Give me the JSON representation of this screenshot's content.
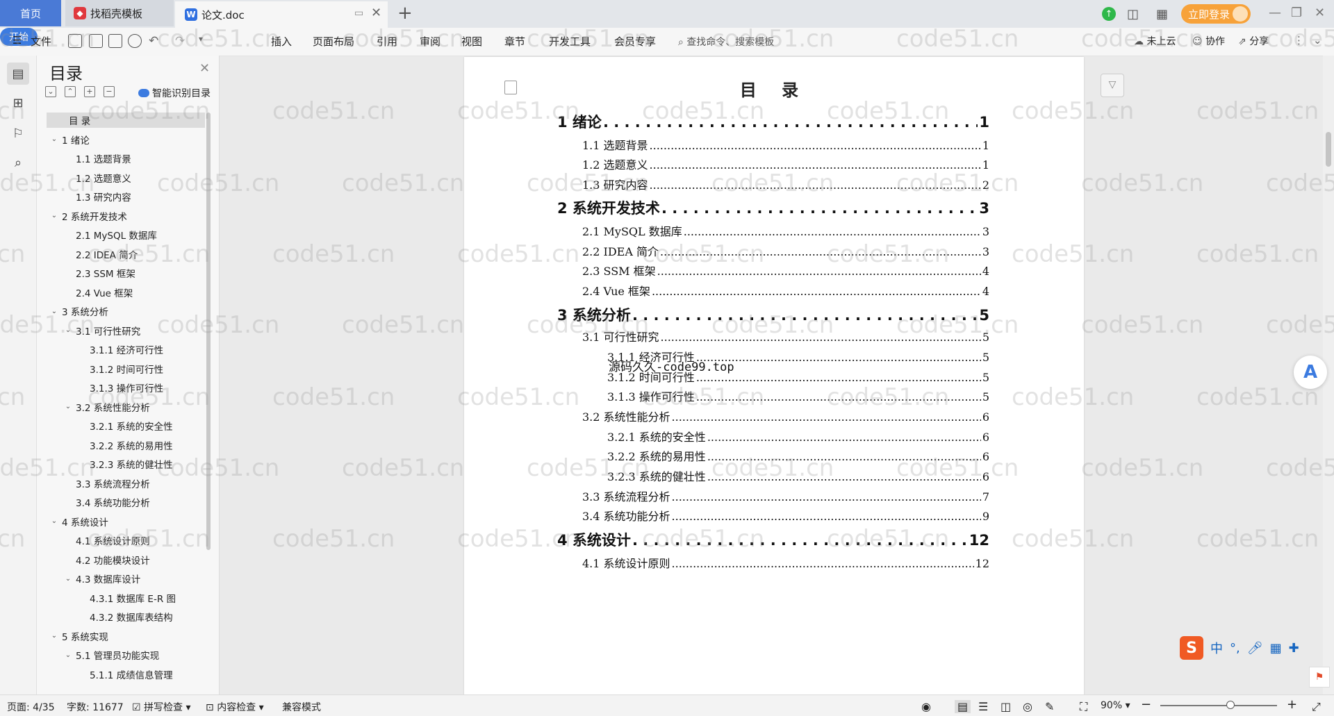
{
  "tabs": {
    "home": "首页",
    "template": "找稻壳模板",
    "doc": "论文.doc",
    "login": "立即登录"
  },
  "ribbon": {
    "file": "文件",
    "items": [
      "开始",
      "插入",
      "页面布局",
      "引用",
      "审阅",
      "视图",
      "章节",
      "开发工具",
      "会员专享"
    ],
    "search": "查找命令、搜索模板",
    "cloud": "未上云",
    "collab": "协作",
    "share": "分享"
  },
  "toc_pane": {
    "title": "目录",
    "smart": "智能识别目录",
    "items": [
      {
        "text": "目  录",
        "level": 0,
        "chev": ""
      },
      {
        "text": "1  绪论",
        "level": 0,
        "chev": "v"
      },
      {
        "text": "1.1  选题背景",
        "level": 1,
        "chev": ""
      },
      {
        "text": "1.2  选题意义",
        "level": 1,
        "chev": ""
      },
      {
        "text": "1.3  研究内容",
        "level": 1,
        "chev": ""
      },
      {
        "text": "2  系统开发技术",
        "level": 0,
        "chev": "v"
      },
      {
        "text": "2.1 MySQL 数据库",
        "level": 1,
        "chev": ""
      },
      {
        "text": "2.2 IDEA 简介",
        "level": 1,
        "chev": ""
      },
      {
        "text": "2.3 SSM 框架",
        "level": 1,
        "chev": ""
      },
      {
        "text": "2.4 Vue 框架",
        "level": 1,
        "chev": ""
      },
      {
        "text": "3  系统分析",
        "level": 0,
        "chev": "v"
      },
      {
        "text": "3.1  可行性研究",
        "level": 1,
        "chev": "v"
      },
      {
        "text": "3.1.1  经济可行性",
        "level": 2,
        "chev": ""
      },
      {
        "text": "3.1.2  时间可行性",
        "level": 2,
        "chev": ""
      },
      {
        "text": "3.1.3  操作可行性",
        "level": 2,
        "chev": ""
      },
      {
        "text": "3.2  系统性能分析",
        "level": 1,
        "chev": "v"
      },
      {
        "text": "3.2.1  系统的安全性",
        "level": 2,
        "chev": ""
      },
      {
        "text": "3.2.2  系统的易用性",
        "level": 2,
        "chev": ""
      },
      {
        "text": "3.2.3  系统的健壮性",
        "level": 2,
        "chev": ""
      },
      {
        "text": "3.3  系统流程分析",
        "level": 1,
        "chev": ""
      },
      {
        "text": "3.4  系统功能分析",
        "level": 1,
        "chev": ""
      },
      {
        "text": "4  系统设计",
        "level": 0,
        "chev": "v"
      },
      {
        "text": "4.1  系统设计原则",
        "level": 1,
        "chev": ""
      },
      {
        "text": "4.2  功能模块设计",
        "level": 1,
        "chev": ""
      },
      {
        "text": "4.3  数据库设计",
        "level": 1,
        "chev": "v"
      },
      {
        "text": "4.3.1  数据库 E-R 图",
        "level": 2,
        "chev": ""
      },
      {
        "text": "4.3.2  数据库表结构",
        "level": 2,
        "chev": ""
      },
      {
        "text": "5  系统实现",
        "level": 0,
        "chev": "v"
      },
      {
        "text": "5.1  管理员功能实现",
        "level": 1,
        "chev": "v"
      },
      {
        "text": "5.1.1  成绩信息管理",
        "level": 2,
        "chev": ""
      }
    ]
  },
  "document": {
    "title": "目 录",
    "stamp": "源码久久-code99.top",
    "entries": [
      {
        "label": "1  绪论",
        "page": "1",
        "level": 1
      },
      {
        "label": "1.1  选题背景",
        "page": "1",
        "level": 2
      },
      {
        "label": "1.2  选题意义",
        "page": "1",
        "level": 2
      },
      {
        "label": "1.3  研究内容",
        "page": "2",
        "level": 2
      },
      {
        "label": "2  系统开发技术",
        "page": "3",
        "level": 1
      },
      {
        "label": "2.1 MySQL 数据库",
        "page": "3",
        "level": 2
      },
      {
        "label": "2.2 IDEA 简介",
        "page": "3",
        "level": 2
      },
      {
        "label": "2.3 SSM 框架",
        "page": "4",
        "level": 2
      },
      {
        "label": "2.4 Vue 框架",
        "page": "4",
        "level": 2
      },
      {
        "label": "3  系统分析",
        "page": "5",
        "level": 1
      },
      {
        "label": "3.1 可行性研究",
        "page": "5",
        "level": 2
      },
      {
        "label": "3.1.1  经济可行性",
        "page": "5",
        "level": 3
      },
      {
        "label": "3.1.2  时间可行性",
        "page": "5",
        "level": 3
      },
      {
        "label": "3.1.3  操作可行性",
        "page": "5",
        "level": 3
      },
      {
        "label": "3.2  系统性能分析",
        "page": "6",
        "level": 2
      },
      {
        "label": "3.2.1  系统的安全性",
        "page": "6",
        "level": 3
      },
      {
        "label": "3.2.2  系统的易用性",
        "page": "6",
        "level": 3
      },
      {
        "label": "3.2.3  系统的健壮性",
        "page": "6",
        "level": 3
      },
      {
        "label": "3.3  系统流程分析",
        "page": "7",
        "level": 2
      },
      {
        "label": "3.4  系统功能分析",
        "page": "9",
        "level": 2
      },
      {
        "label": "4  系统设计",
        "page": "12",
        "level": 1
      },
      {
        "label": "4.1  系统设计原则",
        "page": "12",
        "level": 2
      }
    ]
  },
  "watermark": "code51.cn",
  "statusbar": {
    "page": "页面: 4/35",
    "words": "字数: 11677",
    "spell": "拼写检查",
    "content_check": "内容检查",
    "compat": "兼容模式",
    "zoom": "90%",
    "zoom_level": 0.6
  },
  "ime": {
    "label": "中"
  },
  "colors": {
    "accent": "#3c7be0",
    "login": "#f7a23a",
    "home_tab": "#4a7ad6"
  }
}
